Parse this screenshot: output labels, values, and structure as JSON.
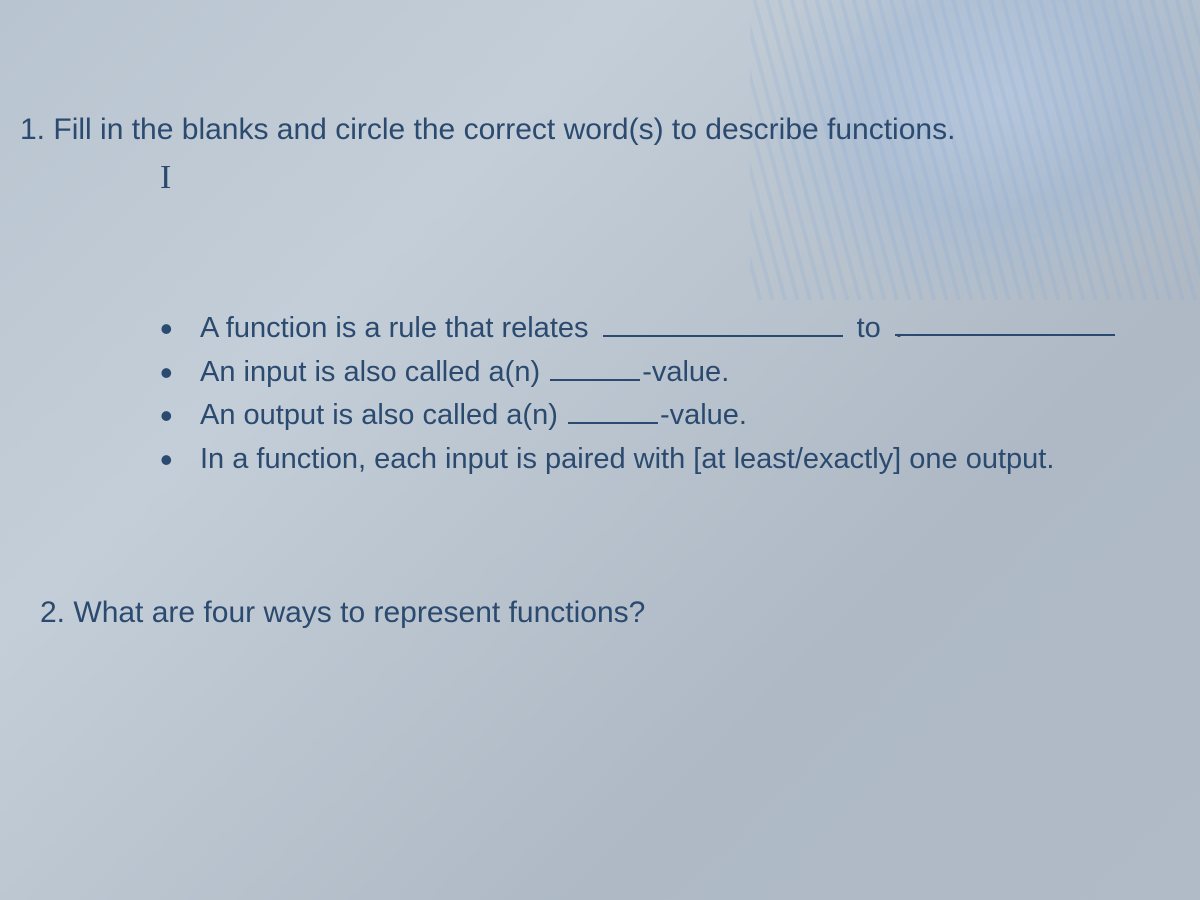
{
  "question1": {
    "number": "1.",
    "prompt": "Fill in the blanks and circle the correct word(s) to describe functions.",
    "cursor": "I",
    "bullets": {
      "b1_part1": "A function is a rule that relates",
      "b1_to": "to",
      "b2_part1": "An input is also called a(n)",
      "b2_suffix": "-value.",
      "b3_part1": "An output is also called a(n)",
      "b3_suffix": "-value.",
      "b4": "In a function, each input is paired with [at least/exactly] one output."
    }
  },
  "question2": {
    "number": "2.",
    "prompt": "What are four ways to represent functions?"
  }
}
